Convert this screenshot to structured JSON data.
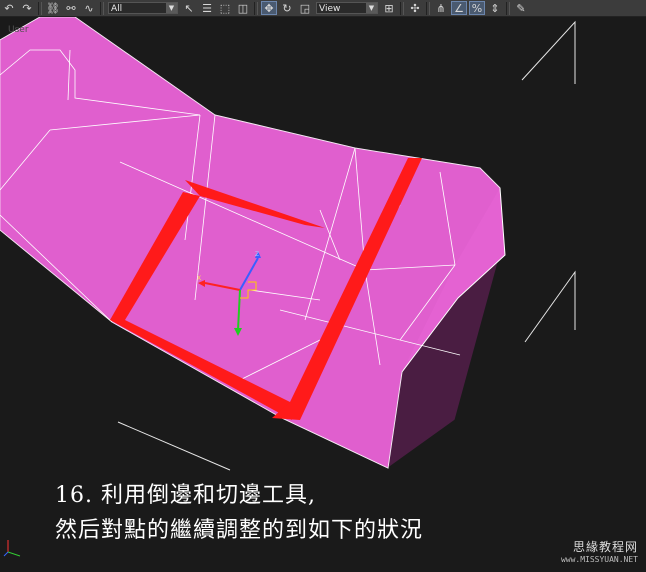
{
  "toolbar": {
    "selection_filter": "All",
    "reference_coord": "View"
  },
  "viewport": {
    "label": "User",
    "caption_line1": "16.  利用倒邊和切邊工具,",
    "caption_line2": "然后對點的繼續調整的到如下的狀況"
  },
  "watermark": {
    "line1": "思緣教程网",
    "line2": "www.MISSYUAN.NET"
  },
  "colors": {
    "mesh_face": "#e462d2",
    "mesh_side": "#4a1d42",
    "selection_edge": "#ff1a1a",
    "background": "#1a1a1a"
  },
  "icons": [
    "undo-icon",
    "redo-icon",
    "link-icon",
    "unlink-icon",
    "bind-space-warp-icon",
    "select-object-icon",
    "select-by-name-icon",
    "rectangular-selection-icon",
    "window-crossing-icon",
    "move-icon",
    "rotate-icon",
    "scale-icon",
    "pivot-icon",
    "mirror-icon",
    "snap-icon",
    "angle-snap-icon",
    "percent-snap-icon",
    "spinner-snap-icon",
    "named-selection-icon"
  ]
}
